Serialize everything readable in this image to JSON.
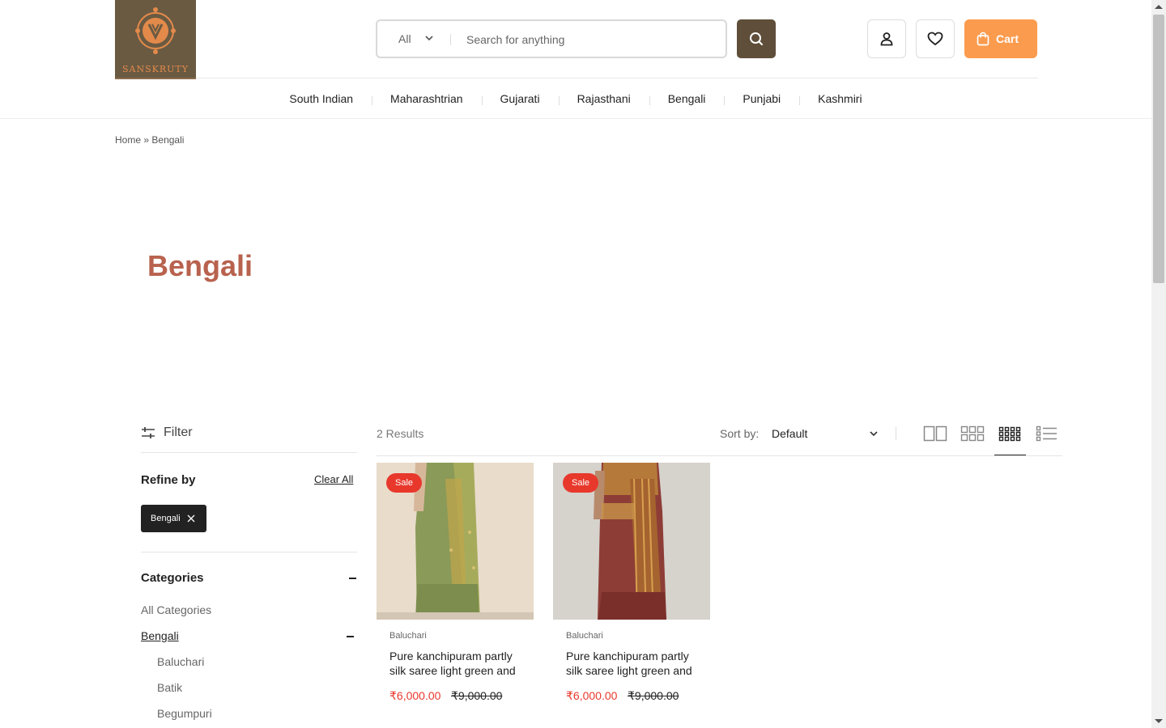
{
  "brand": {
    "logo_text": "SANSKRUTY"
  },
  "search": {
    "category": "All",
    "placeholder": "Search for anything"
  },
  "header": {
    "cart_label": "Cart"
  },
  "nav": [
    {
      "label": "South Indian"
    },
    {
      "label": "Maharashtrian"
    },
    {
      "label": "Gujarati"
    },
    {
      "label": "Rajasthani"
    },
    {
      "label": "Bengali"
    },
    {
      "label": "Punjabi"
    },
    {
      "label": "Kashmiri"
    }
  ],
  "breadcrumb": {
    "home": "Home",
    "separator": "»",
    "current": "Bengali"
  },
  "page": {
    "title": "Bengali"
  },
  "sidebar": {
    "filter_label": "Filter",
    "refine_label": "Refine by",
    "clear_all": "Clear All",
    "active_chip": "Bengali",
    "categories_title": "Categories",
    "categories": [
      {
        "label": "All Categories"
      },
      {
        "label": "Bengali"
      },
      {
        "label": "Baluchari"
      },
      {
        "label": "Batik"
      },
      {
        "label": "Begumpuri"
      }
    ]
  },
  "toolbar": {
    "results": "2 Results",
    "sort_label": "Sort by:",
    "sort_value": "Default"
  },
  "products": [
    {
      "badge": "Sale",
      "category": "Baluchari",
      "name": "Pure kanchipuram partly silk saree light green and",
      "price": "₹6,000.00",
      "old_price": "₹9,000.00"
    },
    {
      "badge": "Sale",
      "category": "Baluchari",
      "name": "Pure kanchipuram partly silk saree light green and",
      "price": "₹6,000.00",
      "old_price": "₹9,000.00"
    }
  ],
  "colors": {
    "accent": "#fb9b4d",
    "brand_brown": "#5f4e39",
    "title": "#b8624e",
    "sale": "#e8382c"
  }
}
